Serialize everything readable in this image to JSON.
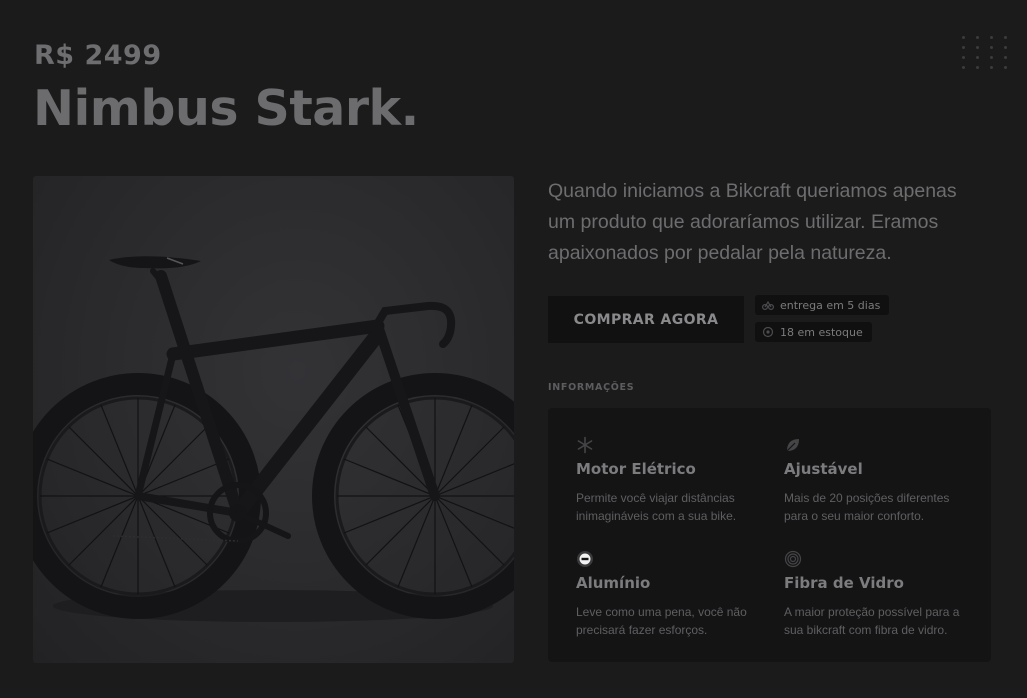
{
  "product": {
    "price": "R$ 2499",
    "name": "Nimbus Stark.",
    "description": "Quando iniciamos a Bikcraft queriamos apenas um produto que adoraríamos utilizar. Eramos apaixonados por pedalar pela natureza.",
    "buy_label": "COMPRAR AGORA",
    "delivery": "entrega em 5 dias",
    "stock": "18 em estoque",
    "image_icon": "bicycle-photo"
  },
  "info": {
    "label": "INFORMAÇÕES",
    "features": [
      {
        "icon": "snowflake-icon",
        "title": "Motor Elétrico",
        "text": "Permite você viajar distâncias inimagináveis com a sua bike."
      },
      {
        "icon": "leaf-icon",
        "title": "Ajustável",
        "text": "Mais de 20 posições diferentes para o seu maior conforto."
      },
      {
        "icon": "aluminum-icon",
        "title": "Alumínio",
        "text": "Leve como uma pena, você não precisará fazer esforços."
      },
      {
        "icon": "fingerprint-icon",
        "title": "Fibra de Vidro",
        "text": "A maior proteção possível para a sua bikcraft com fibra de vidro."
      }
    ]
  },
  "colors": {
    "background": "#1b1b1c",
    "panel": "#141415",
    "button": "#111112"
  }
}
